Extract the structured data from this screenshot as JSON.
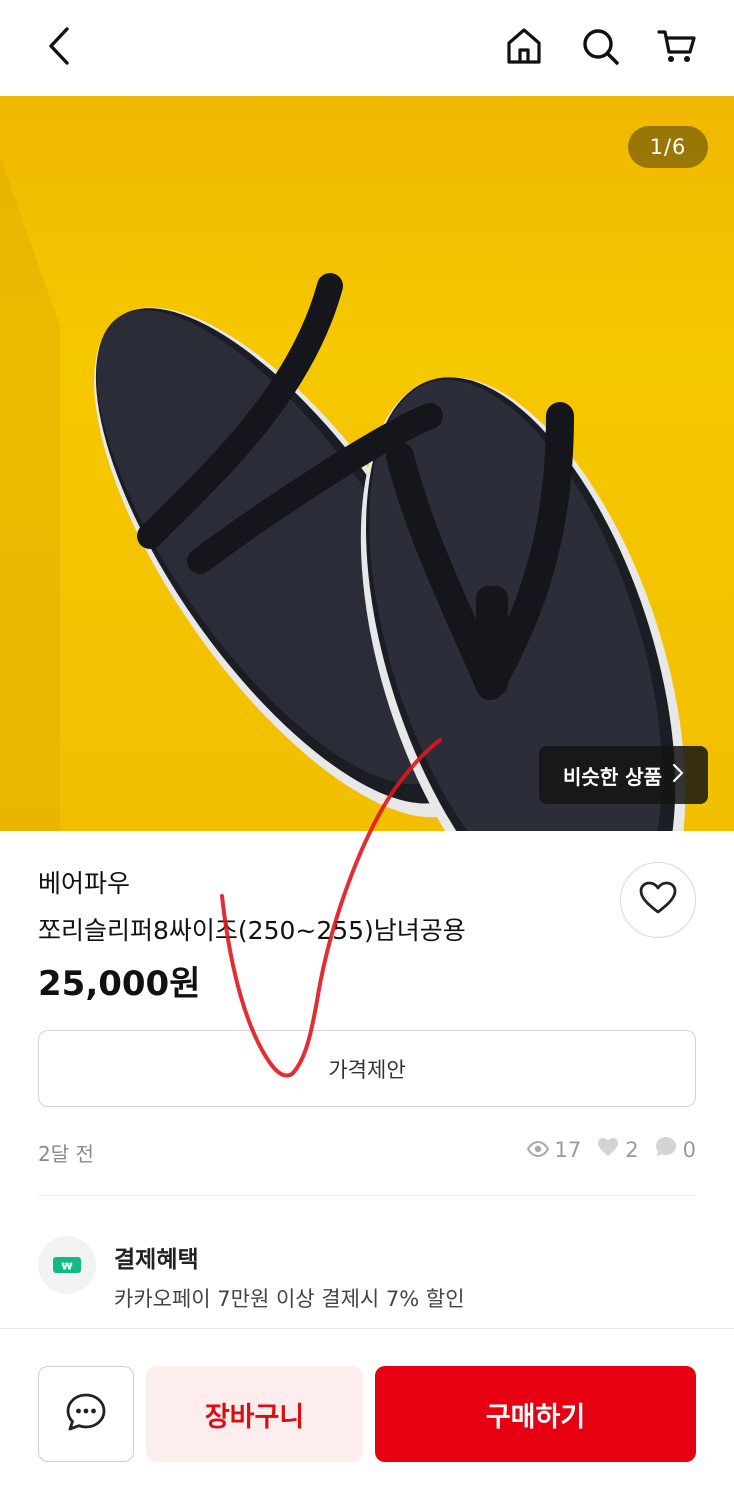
{
  "header": {
    "back_icon": "chevron-left-icon",
    "home_icon": "home-icon",
    "search_icon": "search-icon",
    "cart_icon": "cart-icon"
  },
  "gallery": {
    "counter": "1/6",
    "similar_label": "비슷한 상품",
    "similar_icon": "chevron-right-icon",
    "background_color": "#f5c400"
  },
  "product": {
    "brand": "베어파우",
    "title": "쪼리슬리퍼8싸이즈(250~255)남녀공용",
    "price": "25,000원",
    "offer_label": "가격제안",
    "posted": "2달 전",
    "views": "17",
    "likes": "2",
    "chats": "0"
  },
  "benefit": {
    "title": "결제혜택",
    "description": "카카오페이 7만원 이상 결제시 7% 할인"
  },
  "bottom": {
    "cart_label": "장바구니",
    "buy_label": "구매하기",
    "accent_color": "#e60012"
  }
}
